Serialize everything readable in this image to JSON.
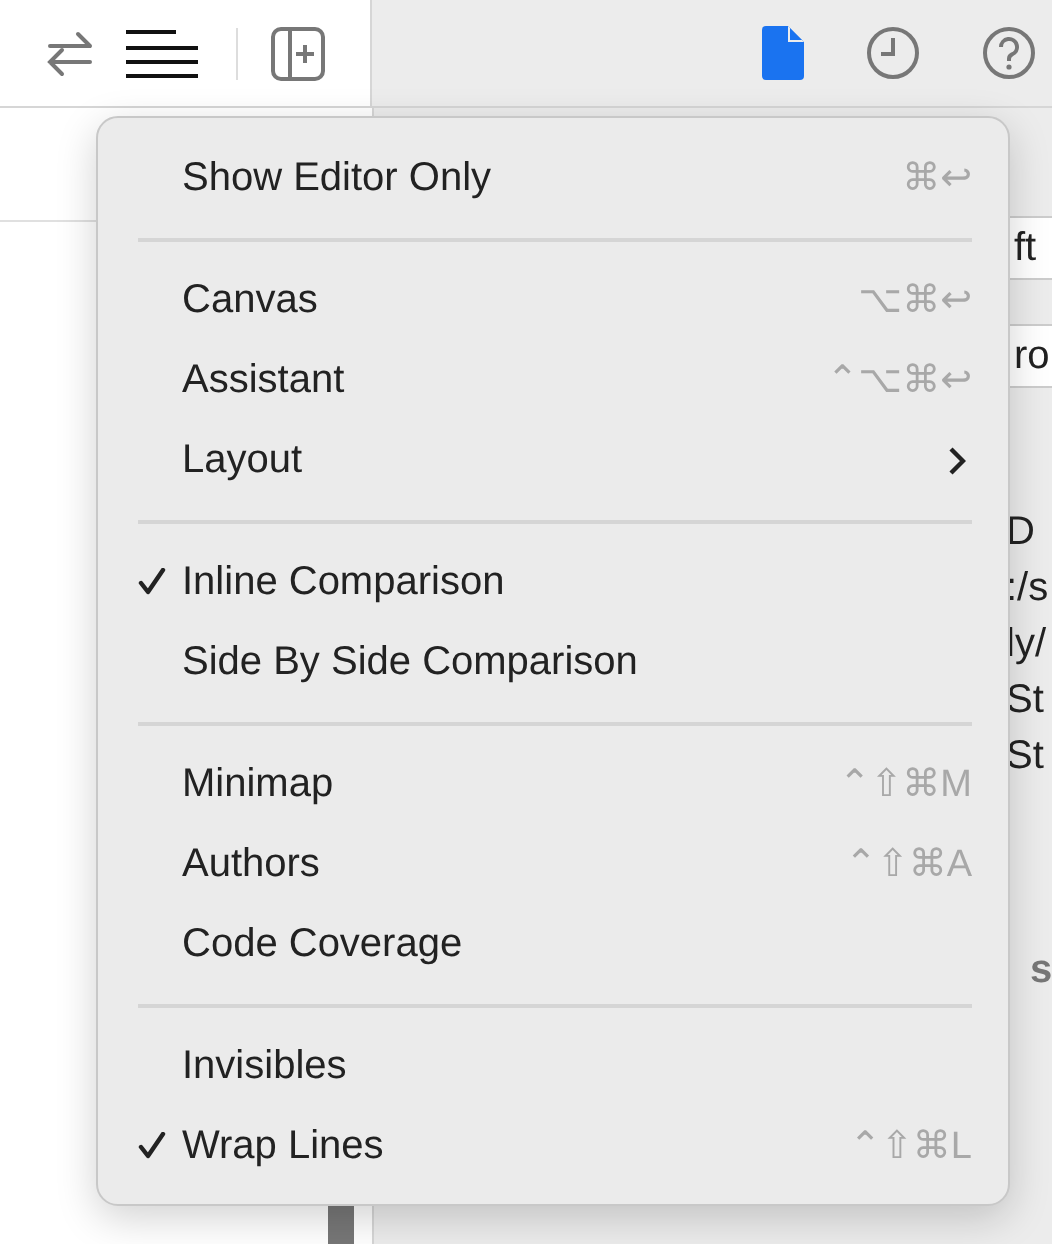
{
  "inspector": {
    "fragments": [
      {
        "text": "ft",
        "kind": "field"
      },
      {
        "text": "ro",
        "kind": "field"
      },
      {
        "text": "D",
        "kind": "line"
      },
      {
        "text": ":/s",
        "kind": "line"
      },
      {
        "text": "ly/",
        "kind": "line"
      },
      {
        "text": "St",
        "kind": "line"
      },
      {
        "text": "St",
        "kind": "line"
      },
      {
        "text": "s",
        "kind": "heading"
      }
    ]
  },
  "menu": {
    "items": [
      {
        "kind": "item",
        "label": "Show Editor Only",
        "shortcut": "⌘↩",
        "checked": false,
        "submenu": false
      },
      {
        "kind": "separator"
      },
      {
        "kind": "item",
        "label": "Canvas",
        "shortcut": "⌥⌘↩",
        "checked": false,
        "submenu": false
      },
      {
        "kind": "item",
        "label": "Assistant",
        "shortcut": "⌃⌥⌘↩",
        "checked": false,
        "submenu": false
      },
      {
        "kind": "item",
        "label": "Layout",
        "checked": false,
        "submenu": true
      },
      {
        "kind": "separator"
      },
      {
        "kind": "item",
        "label": "Inline Comparison",
        "checked": true,
        "submenu": false
      },
      {
        "kind": "item",
        "label": "Side By Side Comparison",
        "checked": false,
        "submenu": false
      },
      {
        "kind": "separator"
      },
      {
        "kind": "item",
        "label": "Minimap",
        "shortcut": "⌃⇧⌘M",
        "checked": false,
        "submenu": false
      },
      {
        "kind": "item",
        "label": "Authors",
        "shortcut": "⌃⇧⌘A",
        "checked": false,
        "submenu": false
      },
      {
        "kind": "item",
        "label": "Code Coverage",
        "checked": false,
        "submenu": false
      },
      {
        "kind": "separator"
      },
      {
        "kind": "item",
        "label": "Invisibles",
        "checked": false,
        "submenu": false
      },
      {
        "kind": "item",
        "label": "Wrap Lines",
        "shortcut": "⌃⇧⌘L",
        "checked": true,
        "submenu": false
      }
    ]
  }
}
